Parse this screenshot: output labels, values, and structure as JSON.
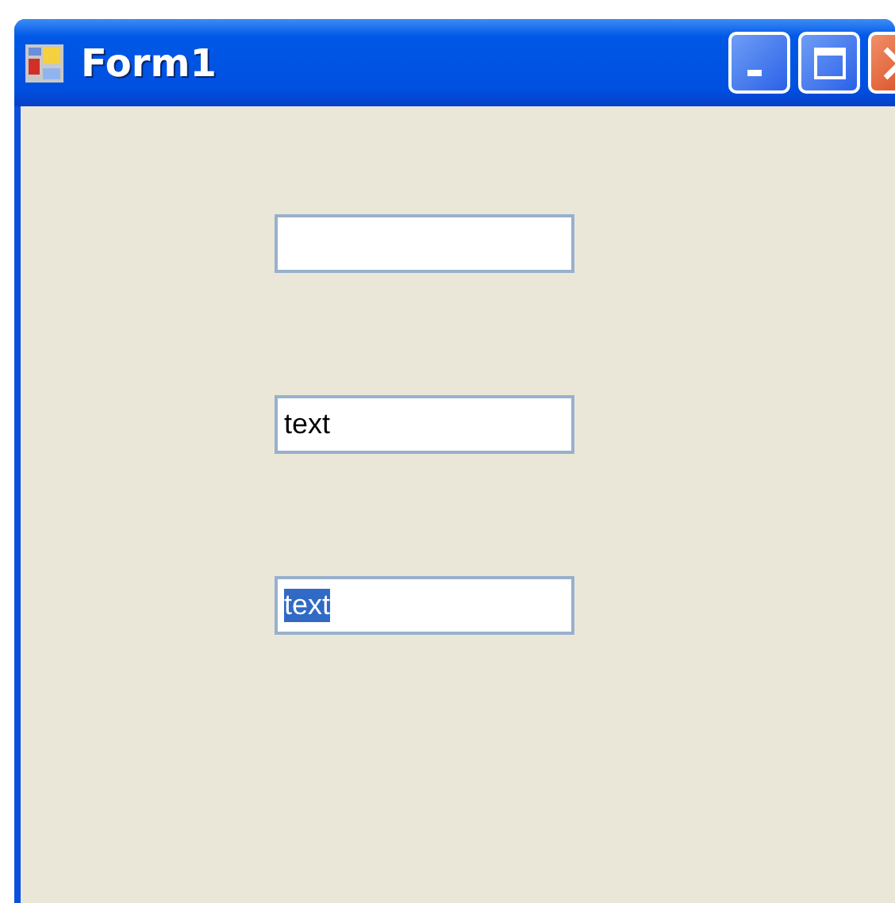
{
  "window": {
    "title": "Form1"
  },
  "fields": [
    {
      "kind": "blank"
    },
    {
      "kind": "text",
      "value": "text",
      "text_selected": false
    },
    {
      "kind": "text",
      "value": "text",
      "text_selected": true
    }
  ]
}
